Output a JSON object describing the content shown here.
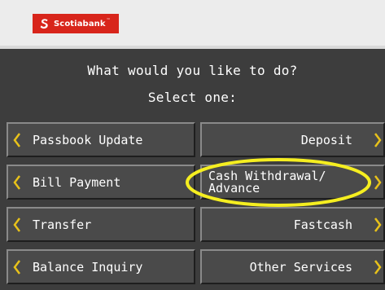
{
  "header": {
    "brand": "Scotiabank",
    "brand_tm": "™",
    "brand_color": "#d8251b"
  },
  "prompt": {
    "line1": "What would you like to do?",
    "line2": "Select one:"
  },
  "options": {
    "passbook_update": "Passbook Update",
    "deposit": "Deposit",
    "bill_payment": "Bill Payment",
    "cash_withdrawal_line1": "Cash Withdrawal/",
    "cash_withdrawal_line2": "Advance",
    "transfer": "Transfer",
    "fastcash": "Fastcash",
    "balance_inquiry": "Balance Inquiry",
    "other_services": "Other Services"
  },
  "icons": {
    "arrow_left": "chevron-left-icon",
    "arrow_right": "chevron-right-icon",
    "logo": "scotiabank-logo-icon"
  },
  "colors": {
    "arrow": "#e8c21a",
    "highlight": "#f5ee20",
    "panel": "#3d3d3d"
  }
}
